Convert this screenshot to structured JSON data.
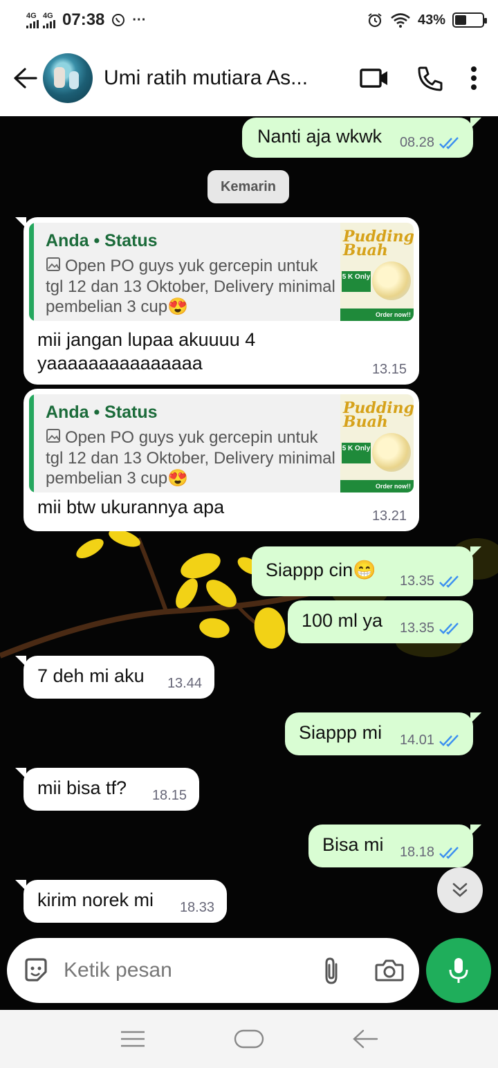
{
  "status_bar": {
    "network1": "4G",
    "network2": "4G",
    "time": "07:38",
    "more": "···",
    "battery_percent": "43%",
    "battery_level": 0.43
  },
  "header": {
    "contact_name": "Umi ratih mutiara As..."
  },
  "date_chip": "Kemarin",
  "messages": [
    {
      "dir": "out",
      "text": "Nanti aja wkwk",
      "time": "08.28"
    },
    {
      "dir": "in",
      "quote_who": "Anda • Status",
      "quote_text": "Open PO guys yuk gercepin untuk tgl 12 dan 13 Oktober, Delivery minimal pembelian 3 cup😍",
      "text": "mii jangan lupaa akuuuu 4 yaaaaaaaaaaaaaaa",
      "time": "13.15"
    },
    {
      "dir": "in",
      "quote_who": "Anda • Status",
      "quote_text": "Open PO guys yuk gercepin untuk tgl 12 dan 13 Oktober, Delivery minimal pembelian 3 cup😍",
      "text": "mii btw ukurannya apa",
      "time": "13.21"
    },
    {
      "dir": "out",
      "text": "Siappp cin😁",
      "time": "13.35"
    },
    {
      "dir": "out",
      "text": "100 ml ya",
      "time": "13.35"
    },
    {
      "dir": "in",
      "text": "7 deh mi aku",
      "time": "13.44"
    },
    {
      "dir": "out",
      "text": "Siappp mi",
      "time": "14.01"
    },
    {
      "dir": "in",
      "text": "mii bisa tf?",
      "time": "18.15"
    },
    {
      "dir": "out",
      "text": "Bisa mi",
      "time": "18.18"
    },
    {
      "dir": "in",
      "text": "kirim norek mi",
      "time": "18.33"
    }
  ],
  "thumbnail": {
    "title1": "Pudding",
    "title2": "Buah",
    "price": "5 K Only",
    "order": "Order now!!"
  },
  "composer": {
    "placeholder": "Ketik pesan"
  },
  "colors": {
    "outgoing_bubble": "#d9fdd3",
    "incoming_bubble": "#ffffff",
    "accent_green": "#1fae5b",
    "read_tick": "#3b8ff0"
  }
}
